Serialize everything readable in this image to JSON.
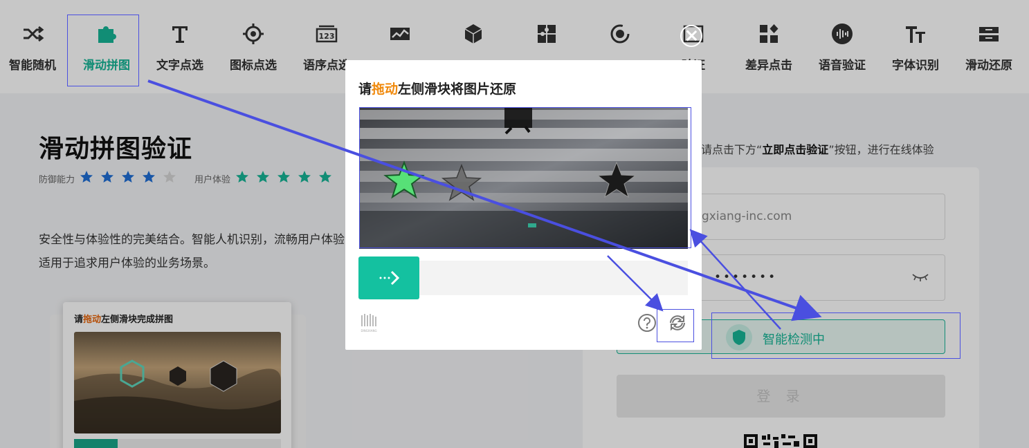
{
  "nav": {
    "items": [
      {
        "label": "智能随机",
        "icon": "shuffle-icon"
      },
      {
        "label": "滑动拼图",
        "icon": "puzzle-icon"
      },
      {
        "label": "文字点选",
        "icon": "text-icon"
      },
      {
        "label": "图标点选",
        "icon": "target-icon"
      },
      {
        "label": "语序点选",
        "icon": "sequence-icon"
      },
      {
        "label": "",
        "icon": "chart-icon"
      },
      {
        "label": "",
        "icon": "cube-icon"
      },
      {
        "label": "",
        "icon": "jigsaw-icon"
      },
      {
        "label": "",
        "icon": "rotate-icon"
      },
      {
        "label": "验证",
        "icon": "image-icon"
      },
      {
        "label": "差异点击",
        "icon": "diff-icon"
      },
      {
        "label": "语音验证",
        "icon": "voice-icon"
      },
      {
        "label": "字体识别",
        "icon": "font-icon"
      },
      {
        "label": "滑动还原",
        "icon": "restore-icon"
      }
    ],
    "active_index": 1,
    "active_color": "#16b596"
  },
  "left": {
    "title": "滑动拼图验证",
    "defense_label": "防御能力",
    "defense_stars": 4,
    "experience_label": "用户体验",
    "experience_stars": 5,
    "star_total": 5,
    "intro_line1": "安全性与体验性的完美结合。智能人机识别，流畅用户体验",
    "intro_line2": "适用于追求用户体验的业务场景。",
    "demo": {
      "title_pre": "请",
      "title_accent": "拖动",
      "title_post": "左侧滑块完成拼图"
    }
  },
  "right": {
    "hint_pre": "请点击下方“",
    "hint_bold": "立即点击验证",
    "hint_post": "”按钮，进行在线体验",
    "email_value": "gxiang-inc.com",
    "password_dots": "•••••••",
    "smart_check_label": "智能检测中",
    "login_label": "登 录"
  },
  "captcha": {
    "title_pre": "请",
    "title_accent": "拖动",
    "title_post": "左侧滑块将图片还原",
    "accent_color": "#f08a0e",
    "button_color": "#14c1a0",
    "logo_text": "DINGXIANG"
  }
}
